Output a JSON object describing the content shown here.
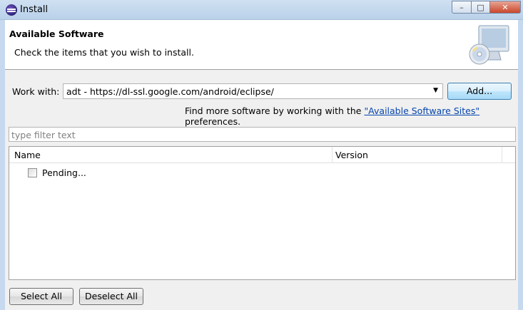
{
  "window": {
    "title": "Install",
    "minimize": "–",
    "maximize": "□",
    "close": "✕"
  },
  "header": {
    "title": "Available Software",
    "description": "Check the items that you wish to install."
  },
  "work_with": {
    "label": "Work with:",
    "value": "adt - https://dl-ssl.google.com/android/eclipse/",
    "add_label": "Add..."
  },
  "find_more": {
    "prefix": "Find more software by working with the ",
    "link": "\"Available Software Sites\"",
    "suffix": " preferences."
  },
  "filter": {
    "placeholder": "type filter text"
  },
  "tree": {
    "columns": [
      "Name",
      "Version"
    ],
    "rows": [
      {
        "name": "Pending...",
        "checked": false
      }
    ]
  },
  "buttons": {
    "select_all": "Select All",
    "deselect_all": "Deselect All"
  },
  "icons": {
    "app": "eclipse-icon",
    "header_art": "computer-disc-icon",
    "dropdown": "chevron-down-icon"
  }
}
